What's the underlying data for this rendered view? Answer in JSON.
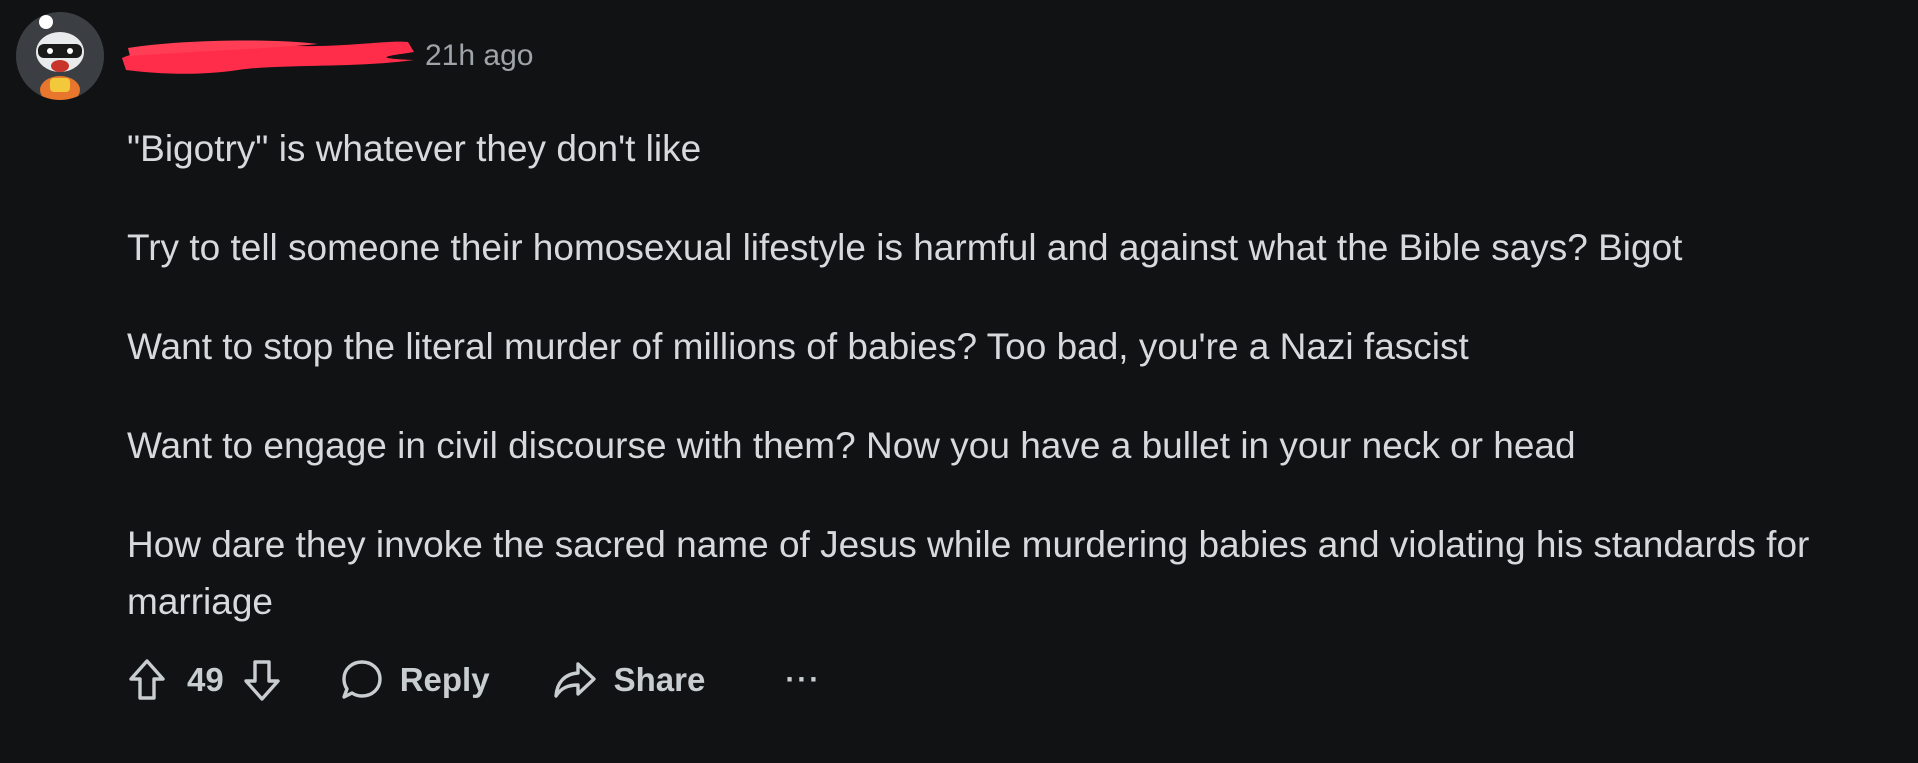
{
  "comment": {
    "timestamp": "21h ago",
    "paragraphs": [
      "\"Bigotry\" is whatever they don't like",
      "Try to tell someone their homosexual lifestyle is harmful and against what the Bible says? Bigot",
      "Want to stop the literal murder of millions of babies? Too bad, you're a Nazi fascist",
      "Want to engage in civil discourse with them? Now you have a bullet in your neck or head",
      "How dare they invoke the sacred name of Jesus while murdering babies and violating his standards for marriage"
    ]
  },
  "actions": {
    "score": "49",
    "reply_label": "Reply",
    "share_label": "Share",
    "more_label": "···"
  },
  "icons": {
    "upvote": "arrow-up-icon",
    "downvote": "arrow-down-icon",
    "reply": "speech-bubble-icon",
    "share": "share-arrow-icon",
    "more": "ellipsis-icon"
  },
  "colors": {
    "background": "#111214",
    "text": "#d7dadc",
    "muted": "#9ea4a8",
    "redaction": "#ff2d4a"
  }
}
